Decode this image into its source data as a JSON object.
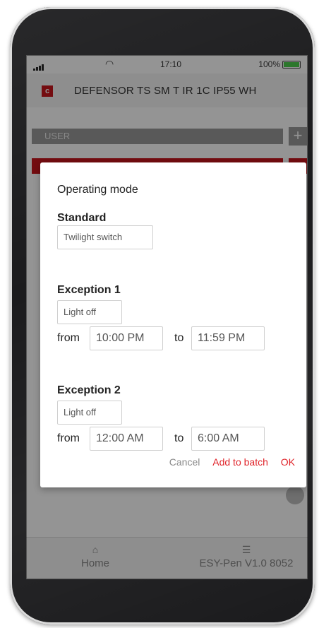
{
  "status_bar": {
    "time": "17:10",
    "battery_text": "100%",
    "battery_color": "#4ccd4c"
  },
  "header": {
    "logo_letter": "c",
    "title": "DEFENSOR TS SM T IR 1C IP55 WH",
    "brand_color": "#c8161d"
  },
  "background_list": {
    "user_label": "USER",
    "plus_label": "+"
  },
  "dialog": {
    "title": "Operating mode",
    "standard": {
      "heading": "Standard",
      "mode": "Twilight switch"
    },
    "exception1": {
      "heading": "Exception 1",
      "mode": "Light off",
      "from_label": "from",
      "from": "10:00 PM",
      "to_label": "to",
      "to": "11:59 PM"
    },
    "exception2": {
      "heading": "Exception 2",
      "mode": "Light off",
      "from_label": "from",
      "from": "12:00 AM",
      "to_label": "to",
      "to": "6:00 AM"
    },
    "actions": {
      "cancel": "Cancel",
      "add_to_batch": "Add to batch",
      "ok": "OK"
    }
  },
  "tabbar": {
    "home_label": "Home",
    "home_icon": "home-icon",
    "version_label": "ESY-Pen V1.0 8052",
    "version_icon": "sliders-icon"
  }
}
